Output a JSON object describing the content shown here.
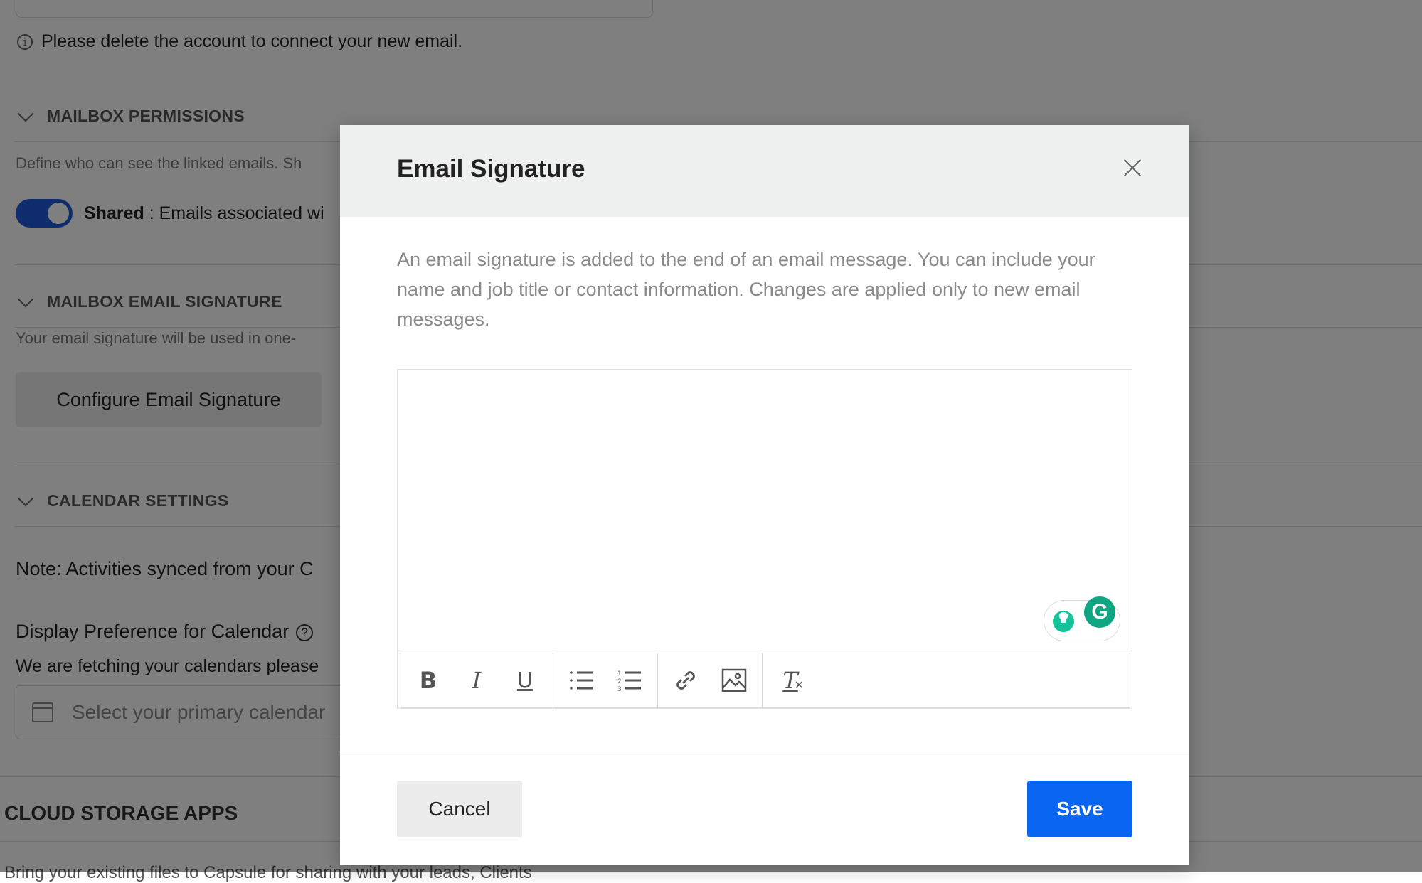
{
  "background": {
    "info_text": "Please delete the account to connect your new email.",
    "mailbox_permissions": {
      "heading": "MAILBOX PERMISSIONS",
      "description": "Define who can see the linked emails. Sh",
      "toggle_label_bold": "Shared",
      "toggle_label_rest": " : Emails associated wi",
      "toggle_on": true
    },
    "mailbox_signature": {
      "heading": "MAILBOX EMAIL SIGNATURE",
      "description": "Your email signature will be used in one-",
      "configure_button": "Configure Email Signature"
    },
    "calendar_settings": {
      "heading": "CALENDAR SETTINGS",
      "note": "Note: Activities synced from your C",
      "display_preference": "Display Preference for Calendar",
      "help_glyph": "?",
      "fetching_text": "We are fetching your calendars please",
      "select_placeholder": "Select your primary calendar"
    },
    "cloud_storage": {
      "heading": "CLOUD STORAGE APPS",
      "sub": "Bring your existing files to Capsule for sharing with your leads, Clients"
    }
  },
  "modal": {
    "title": "Email Signature",
    "description": "An email signature is added to the end of an email message. You can include your name and job title or contact information. Changes are applied only to new email messages.",
    "editor_content": "",
    "toolbar": {
      "bold_glyph": "B",
      "italic_glyph": "I",
      "underline_glyph": "U",
      "clear_glyph": "T"
    },
    "grammarly_glyph": "G",
    "cancel_label": "Cancel",
    "save_label": "Save",
    "accent_color": "#0a66f0"
  }
}
